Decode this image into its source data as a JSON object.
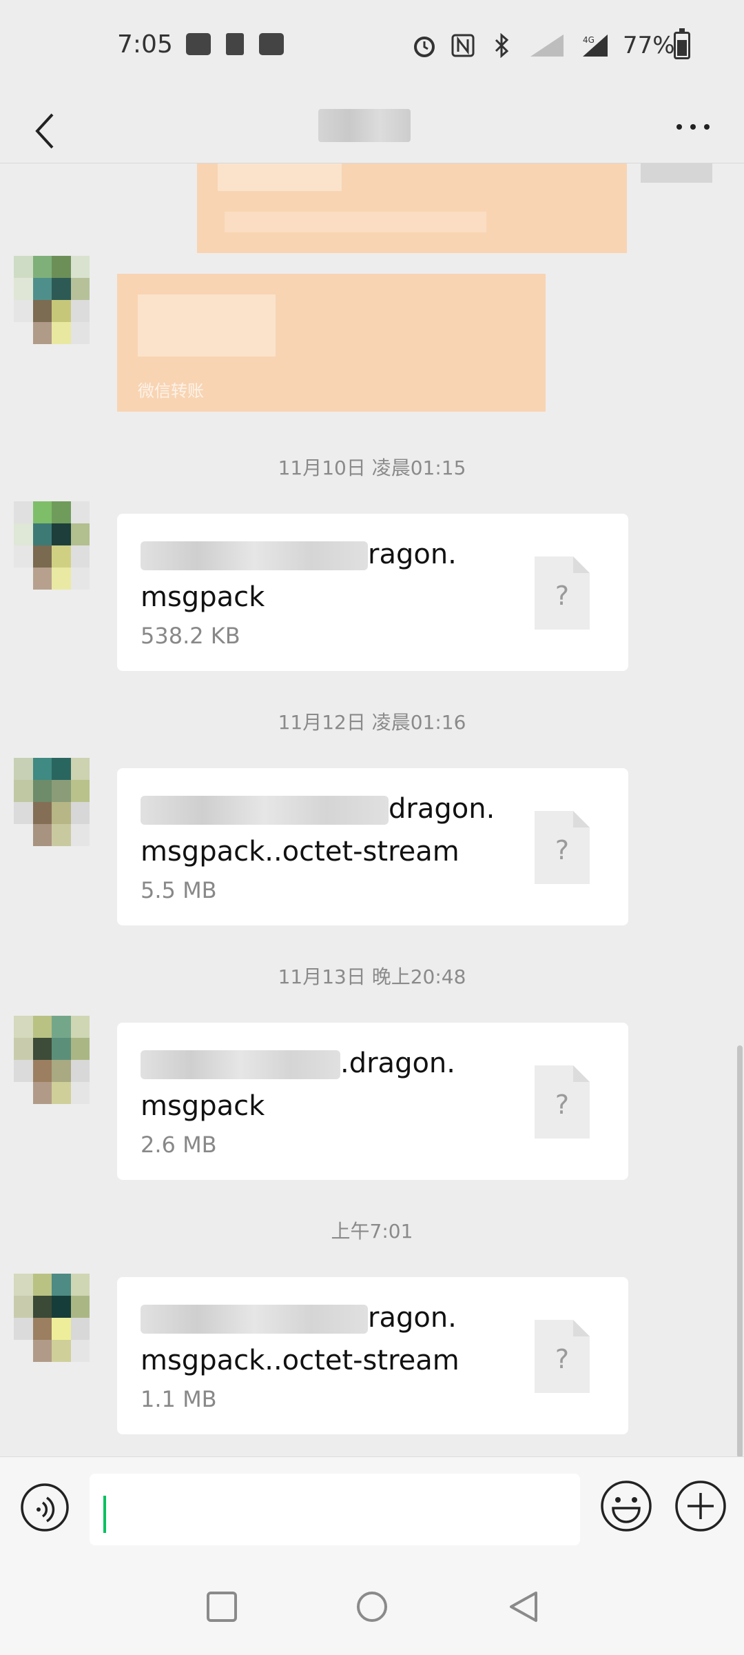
{
  "status_bar": {
    "time": "7:05",
    "battery": "77%",
    "battery_level": 0.77,
    "network": "4G"
  },
  "navbar": {
    "title": "",
    "back_icon": "back-chevron-icon",
    "more_icon": "more-dots-icon"
  },
  "messages": {
    "transfer_caption": "微信转账",
    "timestamps": [
      "11月10日 凌晨01:15",
      "11月12日 凌晨01:16",
      "11月13日 晚上20:48",
      "上午7:01"
    ],
    "files": [
      {
        "name_visible_line1": "ragon.",
        "name_visible_line2": "msgpack",
        "size": "538.2 KB"
      },
      {
        "name_visible_line1": "dragon.",
        "name_visible_line2": "msgpack..octet-stream",
        "size": "5.5 MB"
      },
      {
        "name_visible_line1": ".dragon.",
        "name_visible_line2": "msgpack",
        "size": "2.6 MB"
      },
      {
        "name_visible_line1": "ragon.",
        "name_visible_line2": "msgpack..octet-stream",
        "size": "1.1 MB"
      }
    ],
    "unknown_file_glyph": "?"
  },
  "input_bar": {
    "value": "",
    "voice_icon": "voice-icon",
    "emoji_icon": "emoji-icon",
    "plus_icon": "plus-icon"
  },
  "system_nav": {
    "recents_icon": "square-recents-icon",
    "home_icon": "circle-home-icon",
    "back_icon": "triangle-back-icon"
  },
  "colors": {
    "background": "#ededed",
    "bubble_orange": "#f8d4b3",
    "caret_green": "#07c160",
    "card_white": "#ffffff"
  }
}
